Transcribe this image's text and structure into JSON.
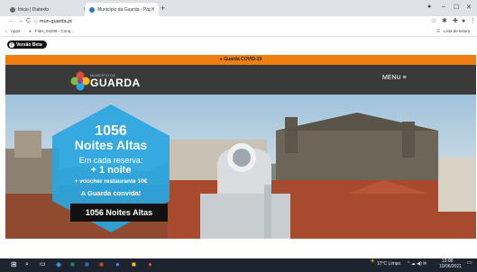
{
  "browser": {
    "tabs": [
      {
        "label": "Inicio | Diatexto",
        "favicon_color": "#6a6a6a"
      },
      {
        "label": "Município da Guarda - Página I...",
        "favicon_color": "#2f6fd8"
      }
    ],
    "url": "mun-guarda.pt",
    "bookmarks": {
      "apps": "Apps",
      "item1": "Files_04209 - Conq...",
      "reading_list": "Lista de leitura"
    }
  },
  "page": {
    "beta_label": "Versão Beta",
    "alert_text": "Guarda COVID-19",
    "logo_top": "MUNICÍPIO DA",
    "logo_text": "GUARDA",
    "menu_label": "MENU ≡",
    "promo": {
      "title1": "1056",
      "title2": "Noites Altas",
      "line1": "Em cada reserva:",
      "line2": "+ 1 noite",
      "line3": "+ voucher restaurante 10€",
      "line4": "A Guarda convida!",
      "button_label": "1056 Noites Altas"
    }
  },
  "taskbar": {
    "weather": "17°C  Limpo",
    "time": "19:08",
    "date": "10/06/2021"
  },
  "colors": {
    "accent_orange": "#f07d10",
    "header_dark": "#3a3a3a",
    "promo_blue": "#2aa6e0"
  }
}
